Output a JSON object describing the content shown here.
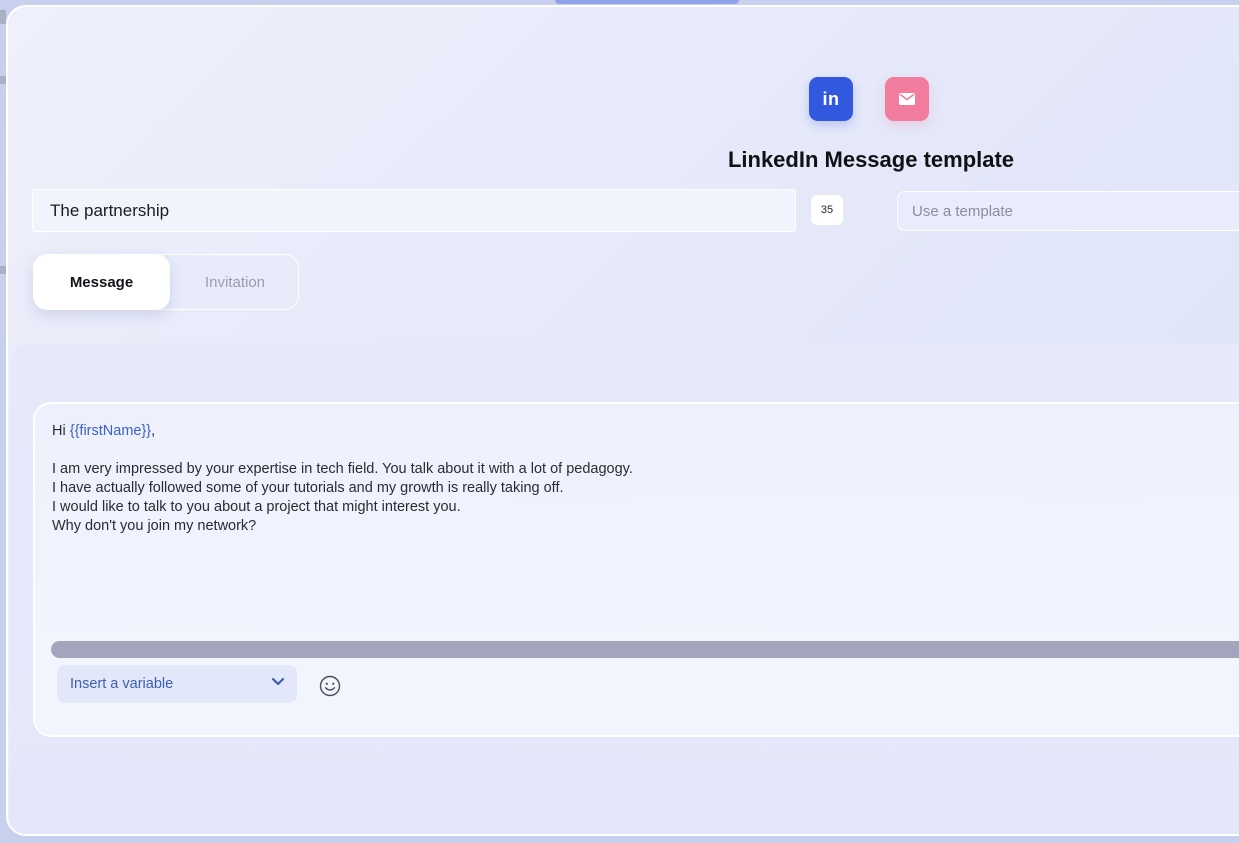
{
  "channels": {
    "linkedin_icon_text": "in",
    "linkedin_icon": "linkedin-icon",
    "email_icon": "mail-icon",
    "linkedin_color": "#3358e0",
    "email_color": "#f27c9d"
  },
  "header": {
    "title": "LinkedIn Message template"
  },
  "form": {
    "template_name": "The partnership",
    "char_count": "35",
    "template_select_placeholder": "Use a template"
  },
  "tabs": [
    {
      "label": "Message",
      "active": true
    },
    {
      "label": "Invitation",
      "active": false
    }
  ],
  "editor": {
    "greeting_prefix": "Hi ",
    "variable_token": "{{firstName}}",
    "greeting_suffix": ",",
    "lines": [
      "I am very impressed by your expertise in tech field. You talk about it with a lot of pedagogy.",
      "I have actually followed some of your tutorials and my growth is really taking off.",
      "I would like to talk to you about a project that might interest you.",
      "Why don't you join my network?"
    ],
    "variable_select_label": "Insert a variable",
    "emoji_icon": "smiley-icon"
  }
}
